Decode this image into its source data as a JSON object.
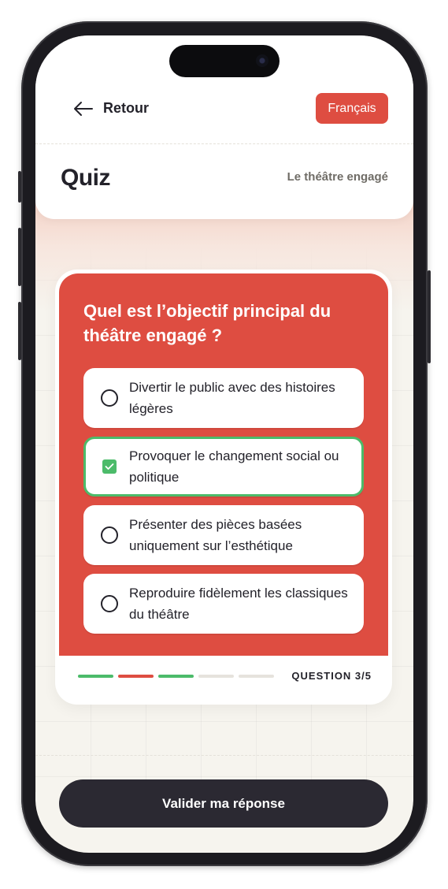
{
  "header": {
    "back_label": "Retour",
    "language_label": "Français",
    "title": "Quiz",
    "subtitle": "Le théâtre engagé"
  },
  "quiz": {
    "question": "Quel est l’objectif principal du théâtre engagé ?",
    "options": [
      {
        "label": "Divertir le public avec des histoires légères",
        "selected": false
      },
      {
        "label": "Provoquer le changement social ou politique",
        "selected": true
      },
      {
        "label": "Présenter des pièces basées uniquement sur l’esthétique",
        "selected": false
      },
      {
        "label": "Reproduire fidèlement les classiques du théâtre",
        "selected": false
      }
    ],
    "progress": [
      "correct",
      "wrong",
      "correct",
      "pending",
      "pending"
    ],
    "question_counter": "QUESTION 3/5"
  },
  "submit_label": "Valider ma réponse",
  "colors": {
    "accent": "#de4d41",
    "correct": "#4cbb6a",
    "pending": "#e6e3dd",
    "dark": "#2b2932"
  },
  "icons": {
    "back": "arrow-left-icon",
    "selected": "checkbox-checked-icon",
    "unselected": "radio-empty-icon"
  }
}
